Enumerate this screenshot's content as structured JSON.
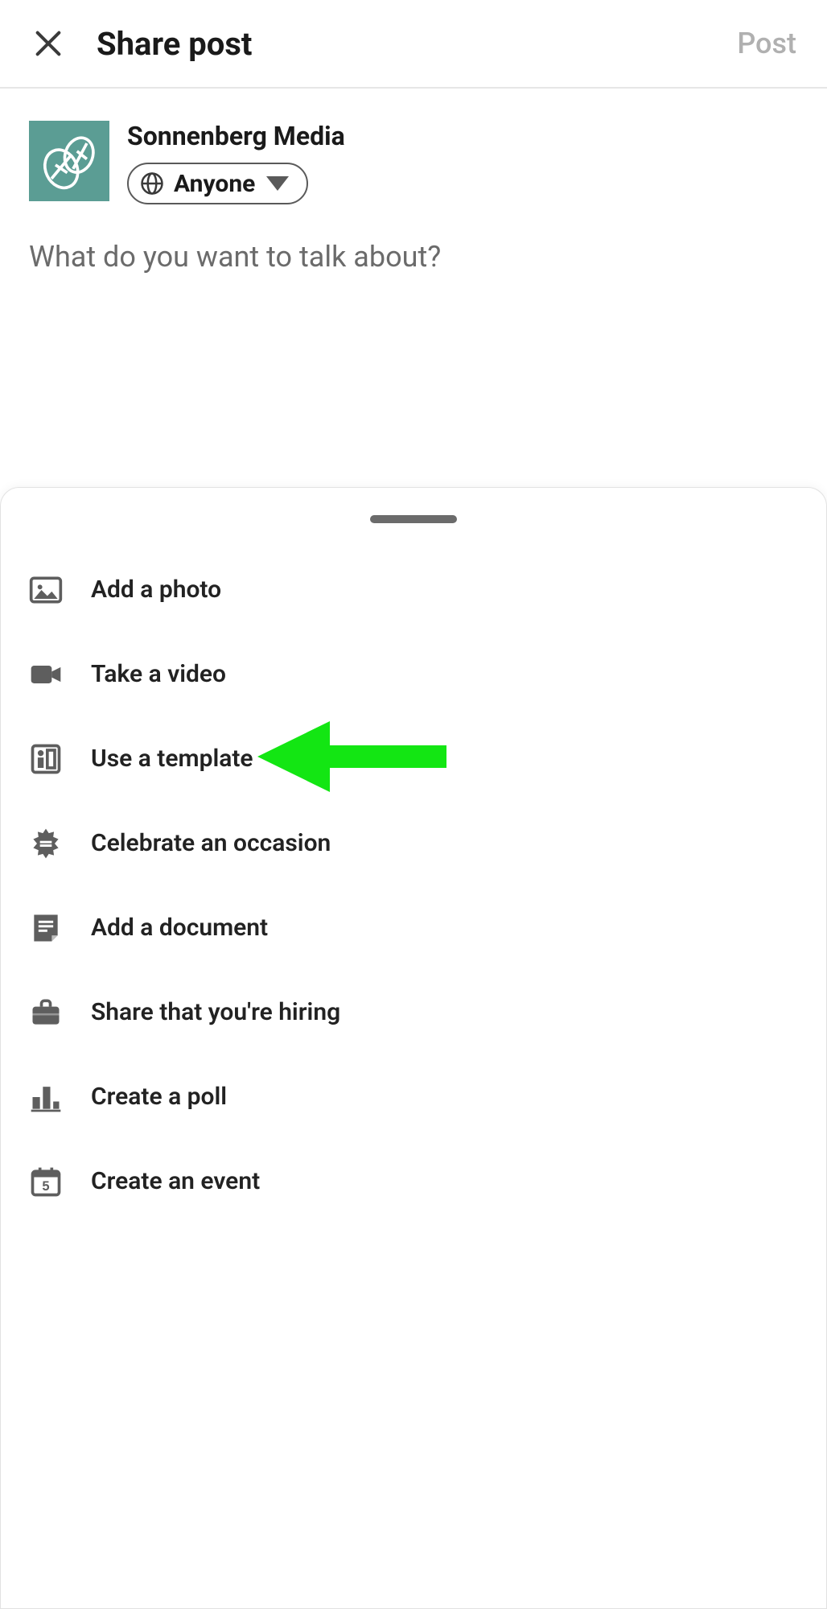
{
  "header": {
    "title": "Share post",
    "post_button": "Post"
  },
  "composer": {
    "author_name": "Sonnenberg Media",
    "audience_label": "Anyone",
    "placeholder": "What do you want to talk about?"
  },
  "sheet_options": [
    {
      "icon": "photo",
      "label": "Add a photo"
    },
    {
      "icon": "video",
      "label": "Take a video"
    },
    {
      "icon": "template",
      "label": "Use a template"
    },
    {
      "icon": "celebrate",
      "label": "Celebrate an occasion"
    },
    {
      "icon": "document",
      "label": "Add a document"
    },
    {
      "icon": "briefcase",
      "label": "Share that you're hiring"
    },
    {
      "icon": "poll",
      "label": "Create a poll"
    },
    {
      "icon": "event",
      "label": "Create an event"
    }
  ],
  "annotation": {
    "arrow_color": "#13e613",
    "points_to_index": 2
  },
  "colors": {
    "avatar_bg": "#5b9d94",
    "icon_gray": "#5e5e5e",
    "placeholder": "#6b6b6b",
    "post_disabled": "#b0b0b0"
  }
}
